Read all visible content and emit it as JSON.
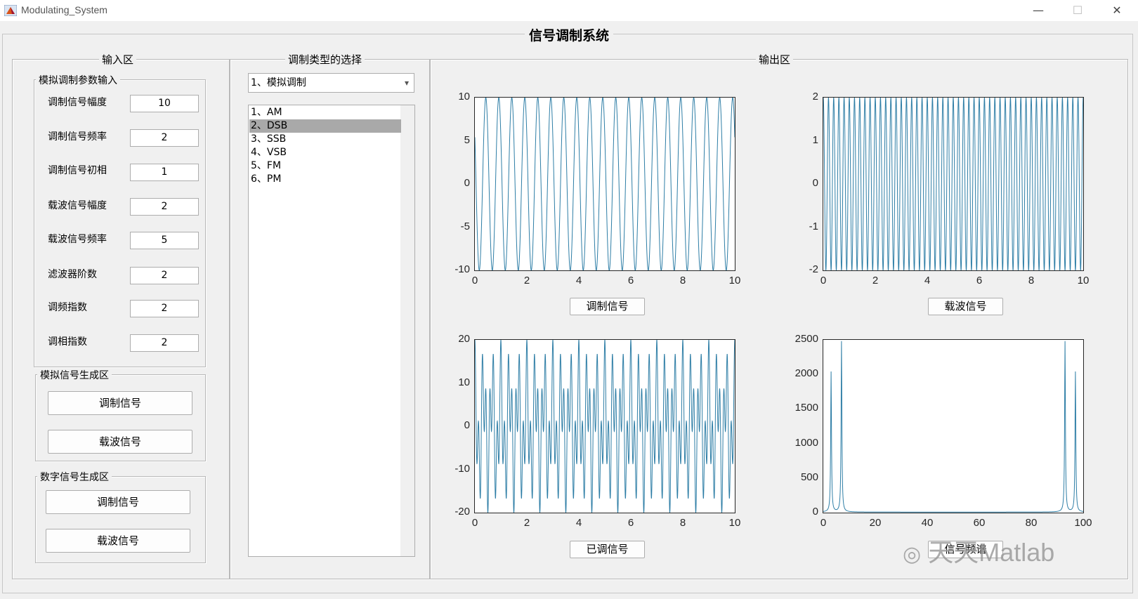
{
  "window": {
    "title": "Modulating_System",
    "minimize_glyph": "—",
    "maximize_glyph": "☐",
    "close_glyph": "✕"
  },
  "system_title": "信号调制系统",
  "input_panel": {
    "title": "输入区",
    "analog_params": {
      "title": "模拟调制参数输入",
      "fields": [
        {
          "label": "调制信号幅度",
          "value": "10"
        },
        {
          "label": "调制信号频率",
          "value": "2"
        },
        {
          "label": "调制信号初相",
          "value": "1"
        },
        {
          "label": "载波信号幅度",
          "value": "2"
        },
        {
          "label": "载波信号频率",
          "value": "5"
        },
        {
          "label": "滤波器阶数",
          "value": "2"
        },
        {
          "label": "调频指数",
          "value": "2"
        },
        {
          "label": "调相指数",
          "value": "2"
        }
      ]
    },
    "analog_gen": {
      "title": "模拟信号生成区",
      "buttons": [
        "调制信号",
        "载波信号"
      ]
    },
    "digital_gen": {
      "title": "数字信号生成区",
      "buttons": [
        "调制信号",
        "载波信号"
      ]
    }
  },
  "select_panel": {
    "title": "调制类型的选择",
    "dropdown_value": "1、模拟调制",
    "list_items": [
      "1、AM",
      "2、DSB",
      "3、SSB",
      "4、VSB",
      "5、FM",
      "6、PM"
    ],
    "selected_index": 1
  },
  "output_panel": {
    "title": "输出区",
    "plot_buttons": [
      "调制信号",
      "载波信号",
      "已调信号",
      "信号频谱"
    ]
  },
  "watermark": "天天Matlab",
  "colors": {
    "line": "#2e7ea6",
    "selection": "#a9a9a9",
    "background": "#f0f0f0"
  },
  "chart_data": [
    {
      "type": "line",
      "xticks": [
        "0",
        "2",
        "4",
        "6",
        "8",
        "10"
      ],
      "yticks": [
        "10",
        "5",
        "0",
        "-5",
        "-10"
      ],
      "xlim": [
        0,
        10
      ],
      "ylim": [
        -10,
        10
      ],
      "series": [
        {
          "amplitude": 10,
          "frequency": 2,
          "phase": 1
        }
      ]
    },
    {
      "type": "line",
      "xticks": [
        "0",
        "2",
        "4",
        "6",
        "8",
        "10"
      ],
      "yticks": [
        "2",
        "1",
        "0",
        "-1",
        "-2"
      ],
      "xlim": [
        0,
        10
      ],
      "ylim": [
        -2,
        2
      ],
      "series": [
        {
          "amplitude": 2,
          "frequency": 5,
          "phase": 0
        }
      ]
    },
    {
      "type": "line",
      "xticks": [
        "0",
        "2",
        "4",
        "6",
        "8",
        "10"
      ],
      "yticks": [
        "20",
        "10",
        "0",
        "-10",
        "-20"
      ],
      "xlim": [
        0,
        10
      ],
      "ylim": [
        -20,
        20
      ],
      "series": [
        {
          "modulating_amplitude": 10,
          "modulating_frequency": 2,
          "carrier_amplitude": 2,
          "carrier_frequency": 5
        }
      ]
    },
    {
      "type": "line",
      "xticks": [
        "0",
        "20",
        "40",
        "60",
        "80",
        "100"
      ],
      "yticks": [
        "2500",
        "2000",
        "1500",
        "1000",
        "500",
        "0"
      ],
      "xlim": [
        0,
        100
      ],
      "ylim": [
        0,
        2500
      ],
      "peaks": [
        {
          "x": 3,
          "y": 2030
        },
        {
          "x": 7,
          "y": 2470
        },
        {
          "x": 93,
          "y": 2470
        },
        {
          "x": 97,
          "y": 2030
        }
      ]
    }
  ]
}
